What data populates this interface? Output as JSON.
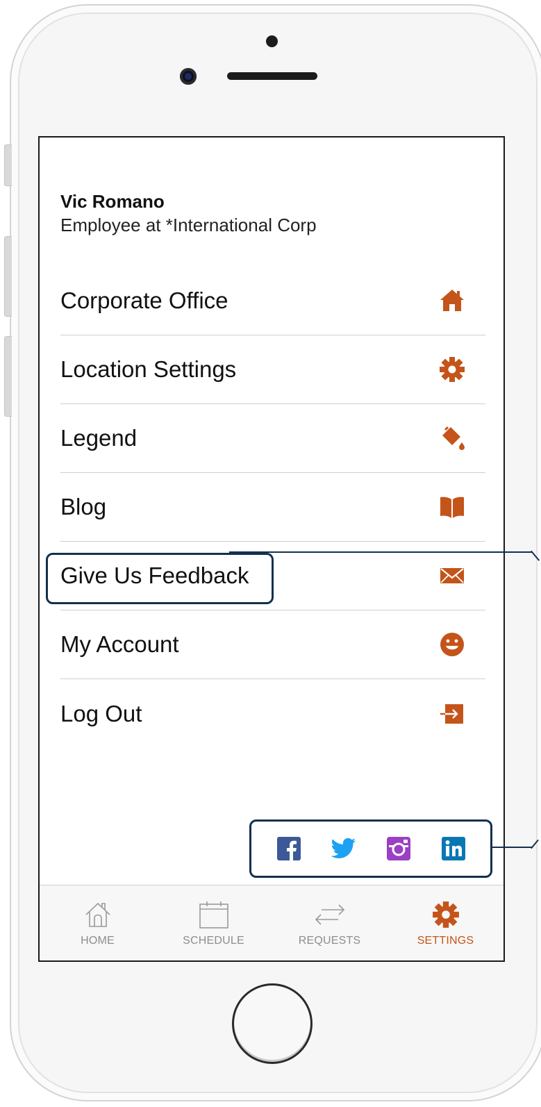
{
  "profile": {
    "name": "Vic Romano",
    "role": "Employee at *International Corp"
  },
  "menu": {
    "items": [
      {
        "label": "Corporate Office",
        "icon": "home-icon"
      },
      {
        "label": "Location Settings",
        "icon": "gear-icon"
      },
      {
        "label": "Legend",
        "icon": "paint-bucket-icon"
      },
      {
        "label": "Blog",
        "icon": "book-icon"
      },
      {
        "label": "Give Us Feedback",
        "icon": "envelope-icon"
      },
      {
        "label": "My Account",
        "icon": "smiley-icon"
      },
      {
        "label": "Log Out",
        "icon": "sign-out-icon"
      }
    ]
  },
  "social": [
    {
      "icon": "facebook-icon",
      "color": "#3b5998"
    },
    {
      "icon": "twitter-icon",
      "color": "#1da1f2"
    },
    {
      "icon": "instagram-icon",
      "color": "#9b3fc4"
    },
    {
      "icon": "linkedin-icon",
      "color": "#0a77b5"
    }
  ],
  "tabs": [
    {
      "label": "HOME",
      "icon": "home-outline-icon",
      "active": false
    },
    {
      "label": "SCHEDULE",
      "icon": "calendar-icon",
      "active": false
    },
    {
      "label": "REQUESTS",
      "icon": "swap-arrows-icon",
      "active": false
    },
    {
      "label": "SETTINGS",
      "icon": "gear-icon",
      "active": true
    }
  ],
  "colors": {
    "accent": "#c4541a",
    "callout": "#12304f",
    "tab_inactive": "#8d8d8d"
  }
}
